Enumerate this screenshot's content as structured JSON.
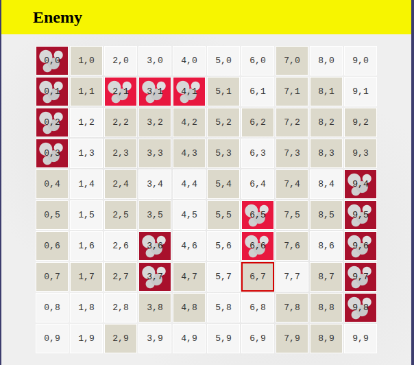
{
  "title": "Enemy",
  "grid": {
    "rows": [
      {
        "cells": [
          {
            "label": "0,0",
            "state": "sunk",
            "selected": false
          },
          {
            "label": "1,0",
            "state": "miss",
            "selected": false
          },
          {
            "label": "2,0",
            "state": "empty",
            "selected": false
          },
          {
            "label": "3,0",
            "state": "empty",
            "selected": false
          },
          {
            "label": "4,0",
            "state": "empty",
            "selected": false
          },
          {
            "label": "5,0",
            "state": "empty",
            "selected": false
          },
          {
            "label": "6,0",
            "state": "empty",
            "selected": false
          },
          {
            "label": "7,0",
            "state": "miss",
            "selected": false
          },
          {
            "label": "8,0",
            "state": "empty",
            "selected": false
          },
          {
            "label": "9,0",
            "state": "empty",
            "selected": false
          }
        ]
      },
      {
        "cells": [
          {
            "label": "0,1",
            "state": "sunk",
            "selected": false
          },
          {
            "label": "1,1",
            "state": "miss",
            "selected": false
          },
          {
            "label": "2,1",
            "state": "hit",
            "selected": false
          },
          {
            "label": "3,1",
            "state": "hit",
            "selected": false
          },
          {
            "label": "4,1",
            "state": "hit",
            "selected": false
          },
          {
            "label": "5,1",
            "state": "miss",
            "selected": false
          },
          {
            "label": "6,1",
            "state": "empty",
            "selected": false
          },
          {
            "label": "7,1",
            "state": "miss",
            "selected": false
          },
          {
            "label": "8,1",
            "state": "miss",
            "selected": false
          },
          {
            "label": "9,1",
            "state": "empty",
            "selected": false
          }
        ]
      },
      {
        "cells": [
          {
            "label": "0,2",
            "state": "sunk",
            "selected": false
          },
          {
            "label": "1,2",
            "state": "empty",
            "selected": false
          },
          {
            "label": "2,2",
            "state": "miss",
            "selected": false
          },
          {
            "label": "3,2",
            "state": "miss",
            "selected": false
          },
          {
            "label": "4,2",
            "state": "miss",
            "selected": false
          },
          {
            "label": "5,2",
            "state": "miss",
            "selected": false
          },
          {
            "label": "6,2",
            "state": "miss",
            "selected": false
          },
          {
            "label": "7,2",
            "state": "miss",
            "selected": false
          },
          {
            "label": "8,2",
            "state": "miss",
            "selected": false
          },
          {
            "label": "9,2",
            "state": "miss",
            "selected": false
          }
        ]
      },
      {
        "cells": [
          {
            "label": "0,3",
            "state": "sunk",
            "selected": false
          },
          {
            "label": "1,3",
            "state": "empty",
            "selected": false
          },
          {
            "label": "2,3",
            "state": "miss",
            "selected": false
          },
          {
            "label": "3,3",
            "state": "miss",
            "selected": false
          },
          {
            "label": "4,3",
            "state": "miss",
            "selected": false
          },
          {
            "label": "5,3",
            "state": "miss",
            "selected": false
          },
          {
            "label": "6,3",
            "state": "empty",
            "selected": false
          },
          {
            "label": "7,3",
            "state": "miss",
            "selected": false
          },
          {
            "label": "8,3",
            "state": "miss",
            "selected": false
          },
          {
            "label": "9,3",
            "state": "miss",
            "selected": false
          }
        ]
      },
      {
        "cells": [
          {
            "label": "0,4",
            "state": "miss",
            "selected": false
          },
          {
            "label": "1,4",
            "state": "empty",
            "selected": false
          },
          {
            "label": "2,4",
            "state": "miss",
            "selected": false
          },
          {
            "label": "3,4",
            "state": "empty",
            "selected": false
          },
          {
            "label": "4,4",
            "state": "empty",
            "selected": false
          },
          {
            "label": "5,4",
            "state": "miss",
            "selected": false
          },
          {
            "label": "6,4",
            "state": "empty",
            "selected": false
          },
          {
            "label": "7,4",
            "state": "miss",
            "selected": false
          },
          {
            "label": "8,4",
            "state": "empty",
            "selected": false
          },
          {
            "label": "9,4",
            "state": "sunk",
            "selected": false
          }
        ]
      },
      {
        "cells": [
          {
            "label": "0,5",
            "state": "miss",
            "selected": false
          },
          {
            "label": "1,5",
            "state": "empty",
            "selected": false
          },
          {
            "label": "2,5",
            "state": "miss",
            "selected": false
          },
          {
            "label": "3,5",
            "state": "miss",
            "selected": false
          },
          {
            "label": "4,5",
            "state": "empty",
            "selected": false
          },
          {
            "label": "5,5",
            "state": "miss",
            "selected": false
          },
          {
            "label": "6,5",
            "state": "hit",
            "selected": false
          },
          {
            "label": "7,5",
            "state": "miss",
            "selected": false
          },
          {
            "label": "8,5",
            "state": "miss",
            "selected": false
          },
          {
            "label": "9,5",
            "state": "sunk",
            "selected": false
          }
        ]
      },
      {
        "cells": [
          {
            "label": "0,6",
            "state": "miss",
            "selected": false
          },
          {
            "label": "1,6",
            "state": "empty",
            "selected": false
          },
          {
            "label": "2,6",
            "state": "empty",
            "selected": false
          },
          {
            "label": "3,6",
            "state": "sunk",
            "selected": false
          },
          {
            "label": "4,6",
            "state": "empty",
            "selected": false
          },
          {
            "label": "5,6",
            "state": "empty",
            "selected": false
          },
          {
            "label": "6,6",
            "state": "hit",
            "selected": false
          },
          {
            "label": "7,6",
            "state": "miss",
            "selected": false
          },
          {
            "label": "8,6",
            "state": "empty",
            "selected": false
          },
          {
            "label": "9,6",
            "state": "sunk",
            "selected": false
          }
        ]
      },
      {
        "cells": [
          {
            "label": "0,7",
            "state": "miss",
            "selected": false
          },
          {
            "label": "1,7",
            "state": "miss",
            "selected": false
          },
          {
            "label": "2,7",
            "state": "miss",
            "selected": false
          },
          {
            "label": "3,7",
            "state": "sunk",
            "selected": false
          },
          {
            "label": "4,7",
            "state": "miss",
            "selected": false
          },
          {
            "label": "5,7",
            "state": "empty",
            "selected": false
          },
          {
            "label": "6,7",
            "state": "miss",
            "selected": true
          },
          {
            "label": "7,7",
            "state": "empty",
            "selected": false
          },
          {
            "label": "8,7",
            "state": "miss",
            "selected": false
          },
          {
            "label": "9,7",
            "state": "sunk",
            "selected": false
          }
        ]
      },
      {
        "cells": [
          {
            "label": "0,8",
            "state": "empty",
            "selected": false
          },
          {
            "label": "1,8",
            "state": "empty",
            "selected": false
          },
          {
            "label": "2,8",
            "state": "empty",
            "selected": false
          },
          {
            "label": "3,8",
            "state": "miss",
            "selected": false
          },
          {
            "label": "4,8",
            "state": "miss",
            "selected": false
          },
          {
            "label": "5,8",
            "state": "empty",
            "selected": false
          },
          {
            "label": "6,8",
            "state": "empty",
            "selected": false
          },
          {
            "label": "7,8",
            "state": "miss",
            "selected": false
          },
          {
            "label": "8,8",
            "state": "miss",
            "selected": false
          },
          {
            "label": "9,8",
            "state": "sunk",
            "selected": false
          }
        ]
      },
      {
        "cells": [
          {
            "label": "0,9",
            "state": "empty",
            "selected": false
          },
          {
            "label": "1,9",
            "state": "empty",
            "selected": false
          },
          {
            "label": "2,9",
            "state": "miss",
            "selected": false
          },
          {
            "label": "3,9",
            "state": "empty",
            "selected": false
          },
          {
            "label": "4,9",
            "state": "empty",
            "selected": false
          },
          {
            "label": "5,9",
            "state": "empty",
            "selected": false
          },
          {
            "label": "6,9",
            "state": "empty",
            "selected": false
          },
          {
            "label": "7,9",
            "state": "miss",
            "selected": false
          },
          {
            "label": "8,9",
            "state": "miss",
            "selected": false
          },
          {
            "label": "9,9",
            "state": "empty",
            "selected": false
          }
        ]
      }
    ]
  }
}
